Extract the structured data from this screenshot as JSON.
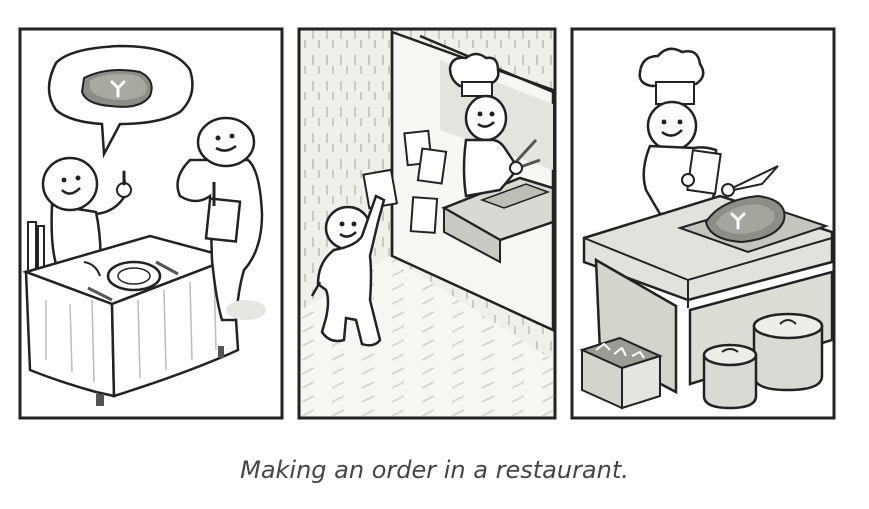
{
  "caption": "Making an order in a restaurant.",
  "panels": [
    {
      "scene": "customer-ordering",
      "icon": "steak-thought-icon"
    },
    {
      "scene": "waiter-posting-order",
      "icon": "order-ticket-icon"
    },
    {
      "scene": "chef-cooking",
      "icon": "chef-hat-icon"
    }
  ],
  "palette": {
    "ink": "#222222",
    "line": "#333333",
    "shade": "#d7d9d2",
    "light": "#eceee8",
    "steak": "#8a8e85"
  }
}
